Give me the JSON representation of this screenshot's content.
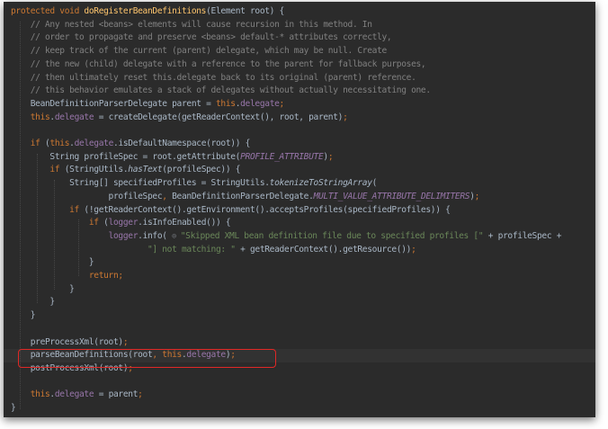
{
  "editor": {
    "lines": [
      [
        [
          "kw",
          "protected "
        ],
        [
          "kw",
          "void "
        ],
        [
          "fn",
          "doRegisterBeanDefinitions"
        ],
        [
          "",
          "(Element root) {"
        ]
      ],
      [
        [
          "cmt",
          "    // Any nested <beans> elements will cause recursion in this method. In"
        ]
      ],
      [
        [
          "cmt",
          "    // order to propagate and preserve <beans> default-* attributes correctly,"
        ]
      ],
      [
        [
          "cmt",
          "    // keep track of the current (parent) delegate, which may be null. Create"
        ]
      ],
      [
        [
          "cmt",
          "    // the new (child) delegate with a reference to the parent for fallback purposes,"
        ]
      ],
      [
        [
          "cmt",
          "    // then ultimately reset this.delegate back to its original (parent) reference."
        ]
      ],
      [
        [
          "cmt",
          "    // this behavior emulates a stack of delegates without actually necessitating one."
        ]
      ],
      [
        [
          "",
          "    BeanDefinitionParserDelegate parent = "
        ],
        [
          "kw",
          "this"
        ],
        [
          "",
          "."
        ],
        [
          "fld",
          "delegate"
        ],
        [
          "kw",
          ";"
        ]
      ],
      [
        [
          "kw",
          "    this"
        ],
        [
          "",
          "."
        ],
        [
          "fld",
          "delegate"
        ],
        [
          "",
          " = createDelegate(getReaderContext(), root, parent)"
        ],
        [
          "kw",
          ";"
        ]
      ],
      [
        [
          "",
          ""
        ]
      ],
      [
        [
          "kw",
          "    if "
        ],
        [
          "",
          "("
        ],
        [
          "kw",
          "this"
        ],
        [
          "",
          "."
        ],
        [
          "fld",
          "delegate"
        ],
        [
          "",
          ".isDefaultNamespace(root)) {"
        ]
      ],
      [
        [
          "",
          "        String profileSpec = root.getAttribute("
        ],
        [
          "cst",
          "PROFILE_ATTRIBUTE"
        ],
        [
          "",
          ")"
        ],
        [
          "kw",
          ";"
        ]
      ],
      [
        [
          "kw",
          "        if "
        ],
        [
          "",
          "(StringUtils."
        ],
        [
          "it",
          "hasText"
        ],
        [
          "",
          "(profileSpec)) {"
        ]
      ],
      [
        [
          "",
          "            String[] specifiedProfiles = StringUtils."
        ],
        [
          "it",
          "tokenizeToStringArray"
        ],
        [
          "",
          "("
        ]
      ],
      [
        [
          "",
          "                    profileSpec"
        ],
        [
          "kw",
          ", "
        ],
        [
          "",
          "BeanDefinitionParserDelegate."
        ],
        [
          "cst",
          "MULTI_VALUE_ATTRIBUTE_DELIMITERS"
        ],
        [
          "",
          ")"
        ],
        [
          "kw",
          ";"
        ]
      ],
      [
        [
          "kw",
          "            if "
        ],
        [
          "",
          "(!getReaderContext().getEnvironment().acceptsProfiles(specifiedProfiles)) {"
        ]
      ],
      [
        [
          "kw",
          "                if "
        ],
        [
          "",
          "("
        ],
        [
          "fld",
          "logger"
        ],
        [
          "",
          ".isInfoEnabled()) {"
        ]
      ],
      [
        [
          "",
          "                    "
        ],
        [
          "fld",
          "logger"
        ],
        [
          "",
          ".info( "
        ],
        [
          "hint",
          "⊙ "
        ],
        [
          "str",
          "\"Skipped XML bean definition file due to specified profiles [\""
        ],
        [
          "",
          " + profileSpec +"
        ]
      ],
      [
        [
          "str",
          "                            \"] not matching: \""
        ],
        [
          "",
          " + getReaderContext().getResource())"
        ],
        [
          "kw",
          ";"
        ]
      ],
      [
        [
          "",
          "                }"
        ]
      ],
      [
        [
          "kw",
          "                return;"
        ]
      ],
      [
        [
          "",
          "            }"
        ]
      ],
      [
        [
          "",
          "        }"
        ]
      ],
      [
        [
          "",
          "    }"
        ]
      ],
      [
        [
          "",
          ""
        ]
      ],
      [
        [
          "",
          "    preProcessXml(root)"
        ],
        [
          "kw",
          ";"
        ]
      ],
      [
        [
          "",
          "    parseBeanDefinitions(root"
        ],
        [
          "kw",
          ", this"
        ],
        [
          "",
          "."
        ],
        [
          "fld",
          "delegate"
        ],
        [
          "",
          ")"
        ],
        [
          "kw",
          ";"
        ]
      ],
      [
        [
          "",
          "    postProcessXml(root)"
        ],
        [
          "kw",
          ";"
        ]
      ],
      [
        [
          "",
          ""
        ]
      ],
      [
        [
          "kw",
          "    this"
        ],
        [
          "",
          "."
        ],
        [
          "fld",
          "delegate"
        ],
        [
          "",
          " = parent"
        ],
        [
          "kw",
          ";"
        ]
      ],
      [
        [
          "",
          "}"
        ]
      ]
    ]
  }
}
